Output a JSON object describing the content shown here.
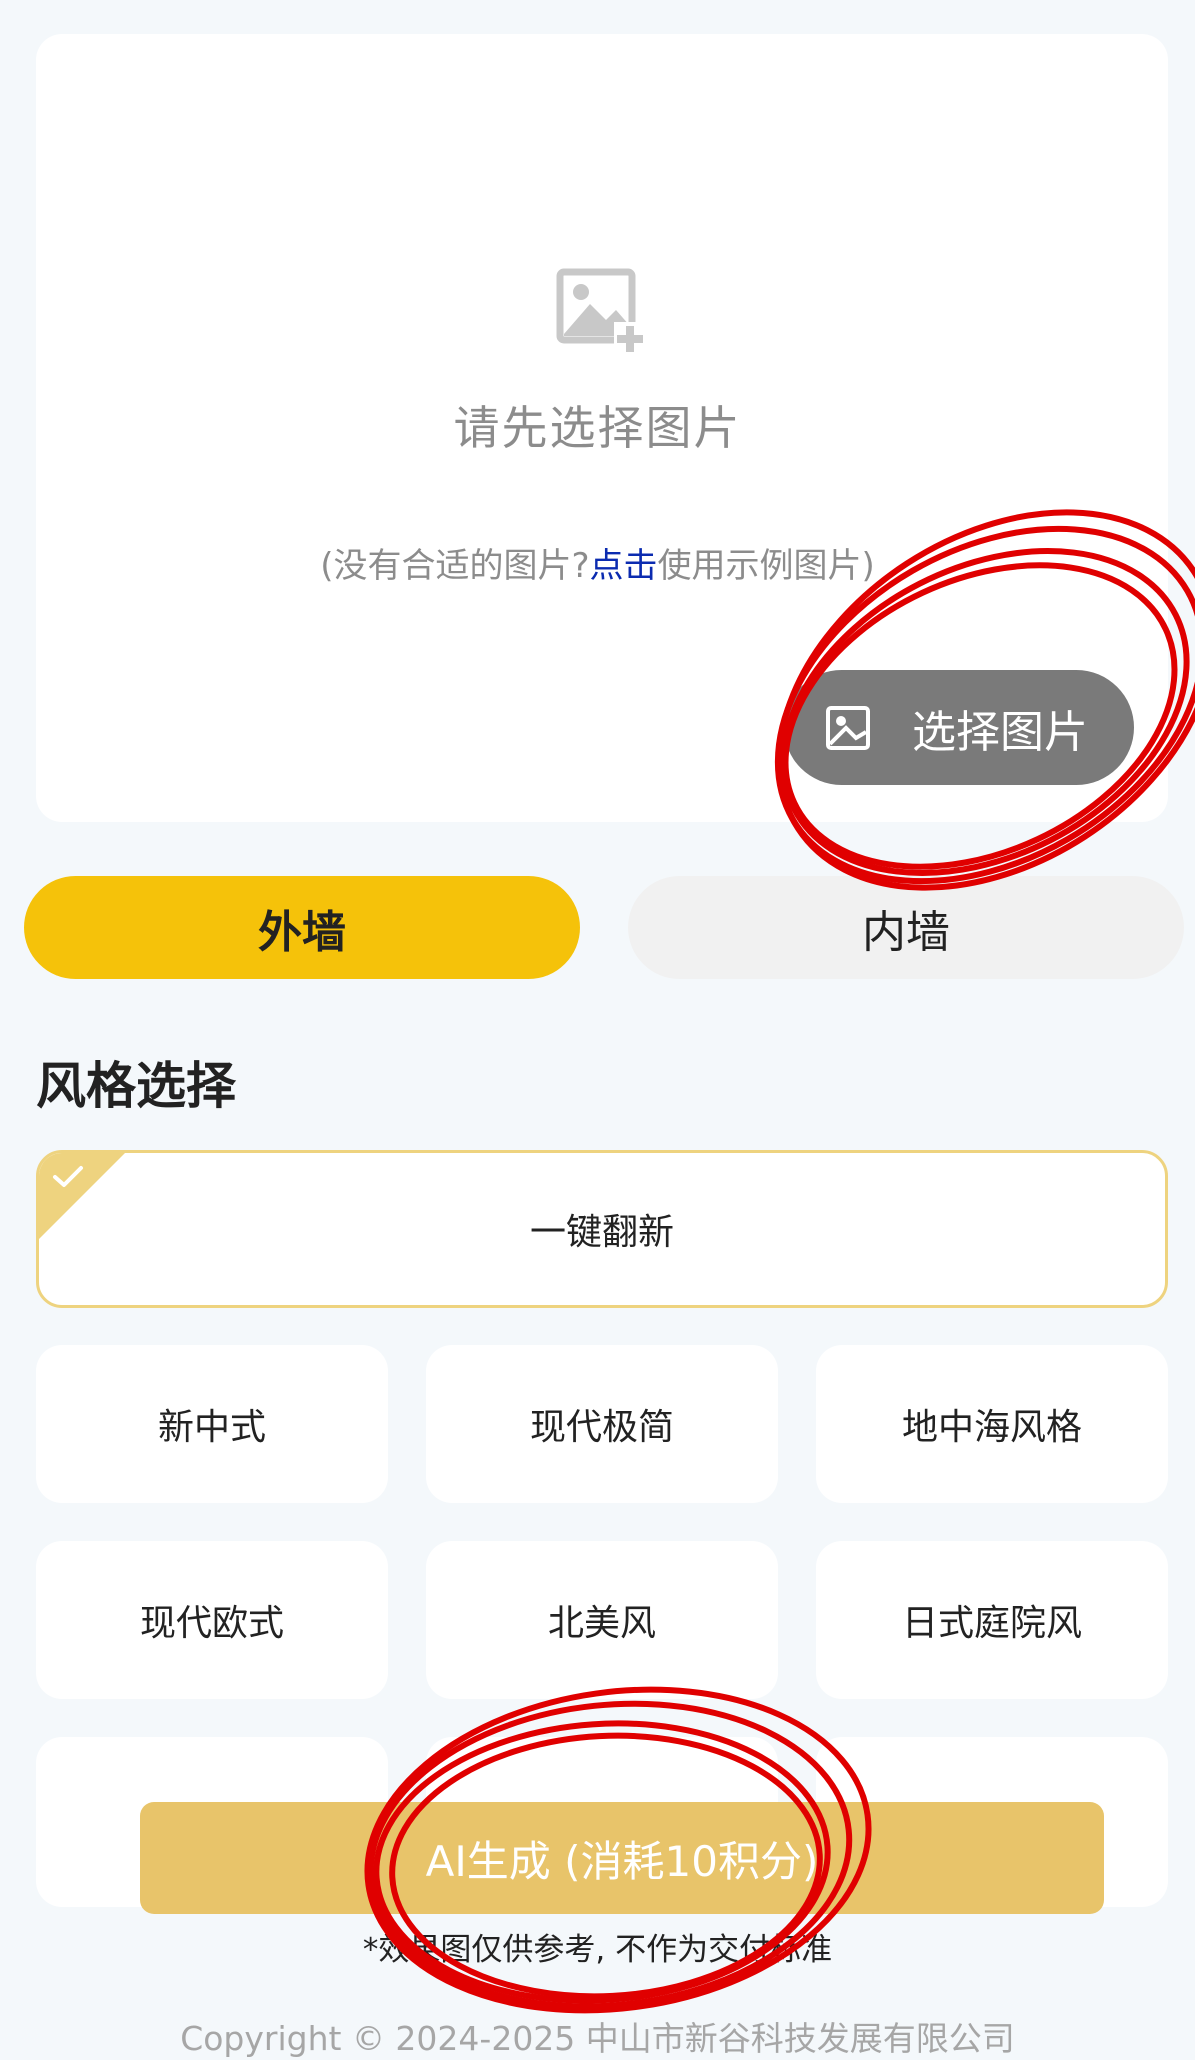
{
  "upload": {
    "title": "请先选择图片",
    "hint_prefix": "(没有合适的图片?",
    "hint_link": "点击",
    "hint_suffix": "使用示例图片)",
    "choose_button": "选择图片",
    "icon": "image-add-icon"
  },
  "tabs": [
    {
      "label": "外墙",
      "active": true
    },
    {
      "label": "内墙",
      "active": false
    }
  ],
  "styles": {
    "section_title": "风格选择",
    "selected": "一键翻新",
    "row1": [
      "新中式",
      "现代极简",
      "地中海风格"
    ],
    "row2": [
      "现代欧式",
      "北美风",
      "日式庭院风"
    ]
  },
  "generate": {
    "button": "AI生成 (消耗10积分)",
    "disclaimer": "*效果图仅供参考, 不作为交付标准"
  },
  "footer": {
    "copyright": "Copyright © 2024-2025 中山市新谷科技发展有限公司"
  },
  "colors": {
    "accent": "#f5c20a",
    "generate_bg": "#e8c46a",
    "annotation": "#e00000"
  }
}
